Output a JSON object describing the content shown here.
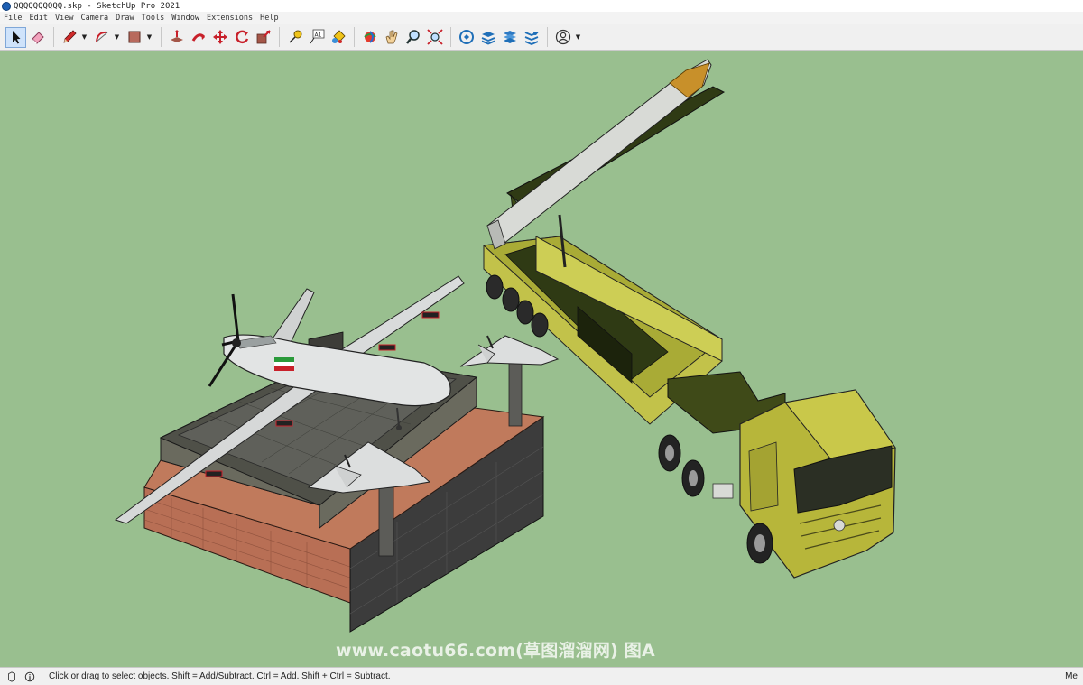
{
  "window": {
    "title": "QQQQQQQQQQ.skp - SketchUp Pro 2021"
  },
  "menu": {
    "items": [
      "File",
      "Edit",
      "View",
      "Camera",
      "Draw",
      "Tools",
      "Window",
      "Extensions",
      "Help"
    ]
  },
  "toolbar": {
    "tools": [
      {
        "name": "select-tool",
        "icon": "arrow-icon"
      },
      {
        "name": "eraser-tool",
        "icon": "eraser-icon"
      },
      {
        "name": "line-tool",
        "icon": "pencil-icon"
      },
      {
        "name": "arc-tool",
        "icon": "arc-icon"
      },
      {
        "name": "shape-tool",
        "icon": "rectangle-icon"
      },
      {
        "name": "push-pull-tool",
        "icon": "push-pull-icon"
      },
      {
        "name": "follow-me-tool",
        "icon": "follow-me-icon"
      },
      {
        "name": "move-tool",
        "icon": "move-icon"
      },
      {
        "name": "rotate-tool",
        "icon": "rotate-icon"
      },
      {
        "name": "scale-tool",
        "icon": "scale-icon"
      },
      {
        "name": "tape-measure-tool",
        "icon": "tape-measure-icon"
      },
      {
        "name": "text-tool",
        "icon": "text-icon"
      },
      {
        "name": "paint-bucket-tool",
        "icon": "paint-bucket-icon"
      },
      {
        "name": "orbit-tool",
        "icon": "orbit-icon"
      },
      {
        "name": "pan-tool",
        "icon": "hand-icon"
      },
      {
        "name": "zoom-tool",
        "icon": "magnifier-icon"
      },
      {
        "name": "zoom-extents-tool",
        "icon": "zoom-extents-icon"
      },
      {
        "name": "3d-warehouse-button",
        "icon": "warehouse-icon"
      },
      {
        "name": "extension-warehouse-button",
        "icon": "extension-icon"
      },
      {
        "name": "layout-button",
        "icon": "layout-icon"
      },
      {
        "name": "extension-manager-button",
        "icon": "extension-manager-icon"
      },
      {
        "name": "account-button",
        "icon": "user-icon"
      }
    ],
    "text_tool_label": "A1"
  },
  "colors": {
    "viewport_bg": "#99bf8f",
    "active_tool": "#cfe3fb",
    "accent_red": "#c8202a"
  },
  "watermark": {
    "text": "www.caotu66.com(草图溜溜网) 图A"
  },
  "status": {
    "message": "Click or drag to select objects. Shift = Add/Subtract. Ctrl = Add. Shift + Ctrl = Subtract.",
    "measurements_label": "Me"
  }
}
